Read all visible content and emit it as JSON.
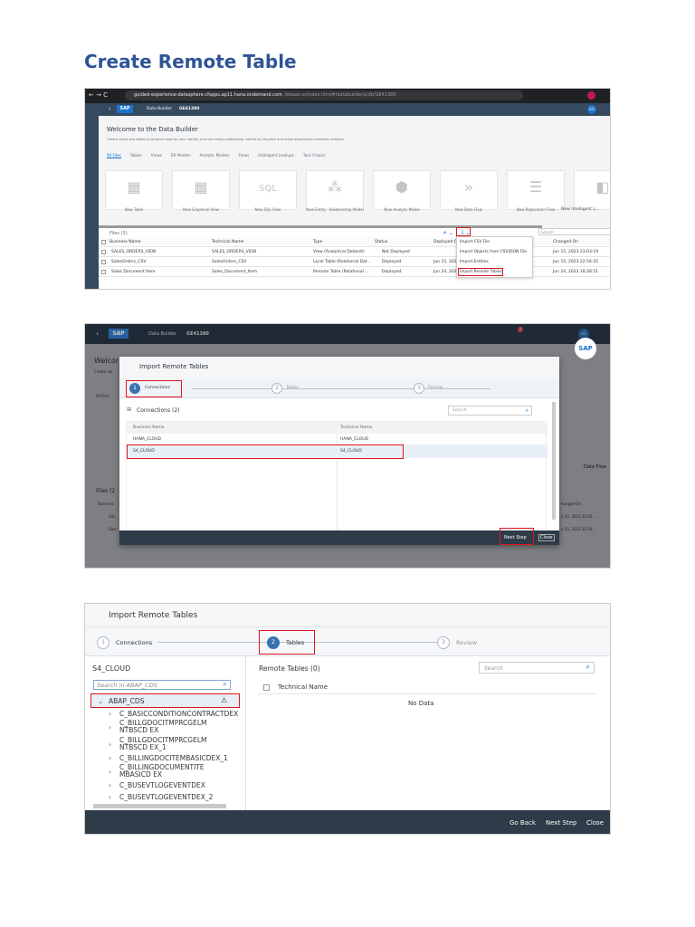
{
  "title": "Create Remote Table",
  "shot1": {
    "url_host": "guided-experience-datasphere.cfapps.ap11.hana.ondemand.com",
    "url_path": "/dwaas-ui/index.html#/databuilder&/db/GE41380",
    "app": "Data Builder",
    "space": "GE41380",
    "avatar": "GG",
    "welcome_title": "Welcome to the Data Builder",
    "welcome_sub": "Create views and tables to prepare data for your stories, and use entity-relationship models to visualize and make associations between artifacts.",
    "tabs": [
      "All Files",
      "Tables",
      "Views",
      "ER Models",
      "Analytic Models",
      "Flows",
      "Intelligent Lookups",
      "Task Chains"
    ],
    "tiles": [
      "New Table",
      "New Graphical View",
      "New SQL View",
      "New Entity - Relationship Model",
      "New Analytic Model",
      "New Data Flow",
      "New Replication Flow",
      "New Intelligent L..."
    ],
    "tile_icons": [
      "table-plus-icon",
      "graphical-view-icon",
      "sql-icon",
      "er-model-icon",
      "analytic-model-icon",
      "data-flow-icon",
      "replication-flow-icon",
      "intelligent-lookup-icon"
    ],
    "files_label": "Files (3)",
    "search_placeholder": "Search",
    "columns": [
      "Business Name",
      "Technical Name",
      "Type",
      "Status",
      "Deployed O",
      "Changed On"
    ],
    "rows": [
      {
        "business": "SALES_ORDERS_VIEW",
        "technical": "SALES_ORDERS_VIEW",
        "type": "View (Analytical Dataset)",
        "status": "Not Deployed",
        "deployed": "",
        "changed": "Jun 15, 2023 23:03:19"
      },
      {
        "business": "SalesOrders_CSV",
        "technical": "SalesOrders_CSV",
        "type": "Local Table (Relational Dat...",
        "status": "Deployed",
        "deployed": "Jun 15, 202",
        "changed": "Jun 15, 2023 22:56:35"
      },
      {
        "business": "Sales Document Item",
        "technical": "Sales_Document_Item",
        "type": "Remote Table (Relational ...",
        "status": "Deployed",
        "deployed": "Jun 24, 202",
        "changed": "Jun 24, 2023 18:28:51"
      }
    ],
    "menu": [
      "Import CSV File",
      "Import Objects from CSV/JSON File",
      "Import Entities",
      "Import Remote Tables"
    ]
  },
  "shot2": {
    "app": "Data Builder",
    "space": "GE41380",
    "avatar": "GG",
    "notif_count": "2",
    "bg_welcome": "Welcor",
    "bg_create": "Create vie",
    "bg_tab": "All Files",
    "bg_files": "Files (2",
    "bg_col": "Business",
    "bg_changed": "hanged On",
    "bg_r1": "SAL",
    "bg_r1_date": "n 15, 2023 23:03...",
    "bg_r2": "Sale",
    "bg_r2_date": "n 15, 2023 22:56...",
    "bg_tile": "Data Flow",
    "dialog_title": "Import Remote Tables",
    "steps": [
      "Connections",
      "Tables",
      "Review"
    ],
    "connections_label": "Connections (2)",
    "search_placeholder": "Search",
    "columns": [
      "Business Name",
      "Technical Name"
    ],
    "rows": [
      {
        "business": "HANA_CLOUD",
        "technical": "HANA_CLOUD"
      },
      {
        "business": "S4_CLOUD",
        "technical": "S4_CLOUD"
      }
    ],
    "next": "Next Step",
    "close": "Close"
  },
  "shot3": {
    "dialog_title": "Import Remote Tables",
    "steps": [
      "Connections",
      "Tables",
      "Review"
    ],
    "source": "S4_CLOUD",
    "tree_search_placeholder": "Search in ABAP_CDS",
    "root": "ABAP_CDS",
    "children": [
      "C_BASICCONDITIONCONTRACTDEX",
      "C_BILLGDOCITMPRCGELMNTBSCD EX",
      "C_BILLGDOCITMPRCGELMNTBSCD EX_1",
      "C_BILLINGDOCITEMBASICDEX_1",
      "C_BILLINGDOCUMENTITEMBASICD EX",
      "C_BUSEVTLOGEVENTDEX",
      "C_BUSEVTLOGEVENTDEX_2"
    ],
    "remote_label": "Remote Tables (0)",
    "search_placeholder": "Search",
    "column": "Technical Name",
    "empty": "No Data",
    "go_back": "Go Back",
    "next": "Next Step",
    "close": "Close"
  }
}
